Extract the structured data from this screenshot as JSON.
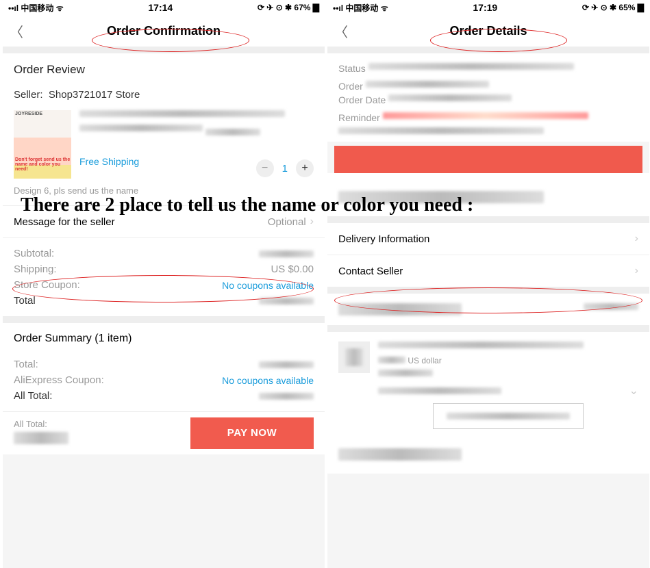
{
  "overlay": "There are 2 place to tell us the name or color you need :",
  "left": {
    "status": {
      "left": "中国移动",
      "time": "17:14",
      "right": "67%"
    },
    "nav_title": "Order Confirmation",
    "order_review_heading": "Order Review",
    "seller_label": "Seller:",
    "seller_name": "Shop3721017 Store",
    "thumb_top": "JOYRESIDE",
    "thumb_bot": "Don't forget send us the name and color you need!",
    "free_shipping": "Free Shipping",
    "qty_value": "1",
    "variant_note": "Design 6, pls send us the name",
    "msg_seller_label": "Message for the seller",
    "msg_seller_hint": "Optional",
    "subtotal_label": "Subtotal:",
    "shipping_label": "Shipping:",
    "shipping_value": "US $0.00",
    "coupon_label": "Store Coupon:",
    "coupon_value": "No coupons available",
    "total_label": "Total",
    "summary_heading": "Order Summary (1 item)",
    "s_total_label": "Total:",
    "s_coupon_label": "AliExpress Coupon:",
    "s_coupon_value": "No coupons available",
    "s_all_total_label": "All Total:",
    "footer_all_total": "All Total:",
    "pay_now": "PAY NOW"
  },
  "right": {
    "status": {
      "left": "中国移动",
      "time": "17:19",
      "right": "65%"
    },
    "nav_title": "Order Details",
    "status_label": "Status",
    "order_label": "Order",
    "order_date_label": "Order Date",
    "reminder_label": "Reminder",
    "delivery_info": "Delivery Information",
    "contact_seller": "Contact Seller",
    "currency_note": "US dollar"
  }
}
